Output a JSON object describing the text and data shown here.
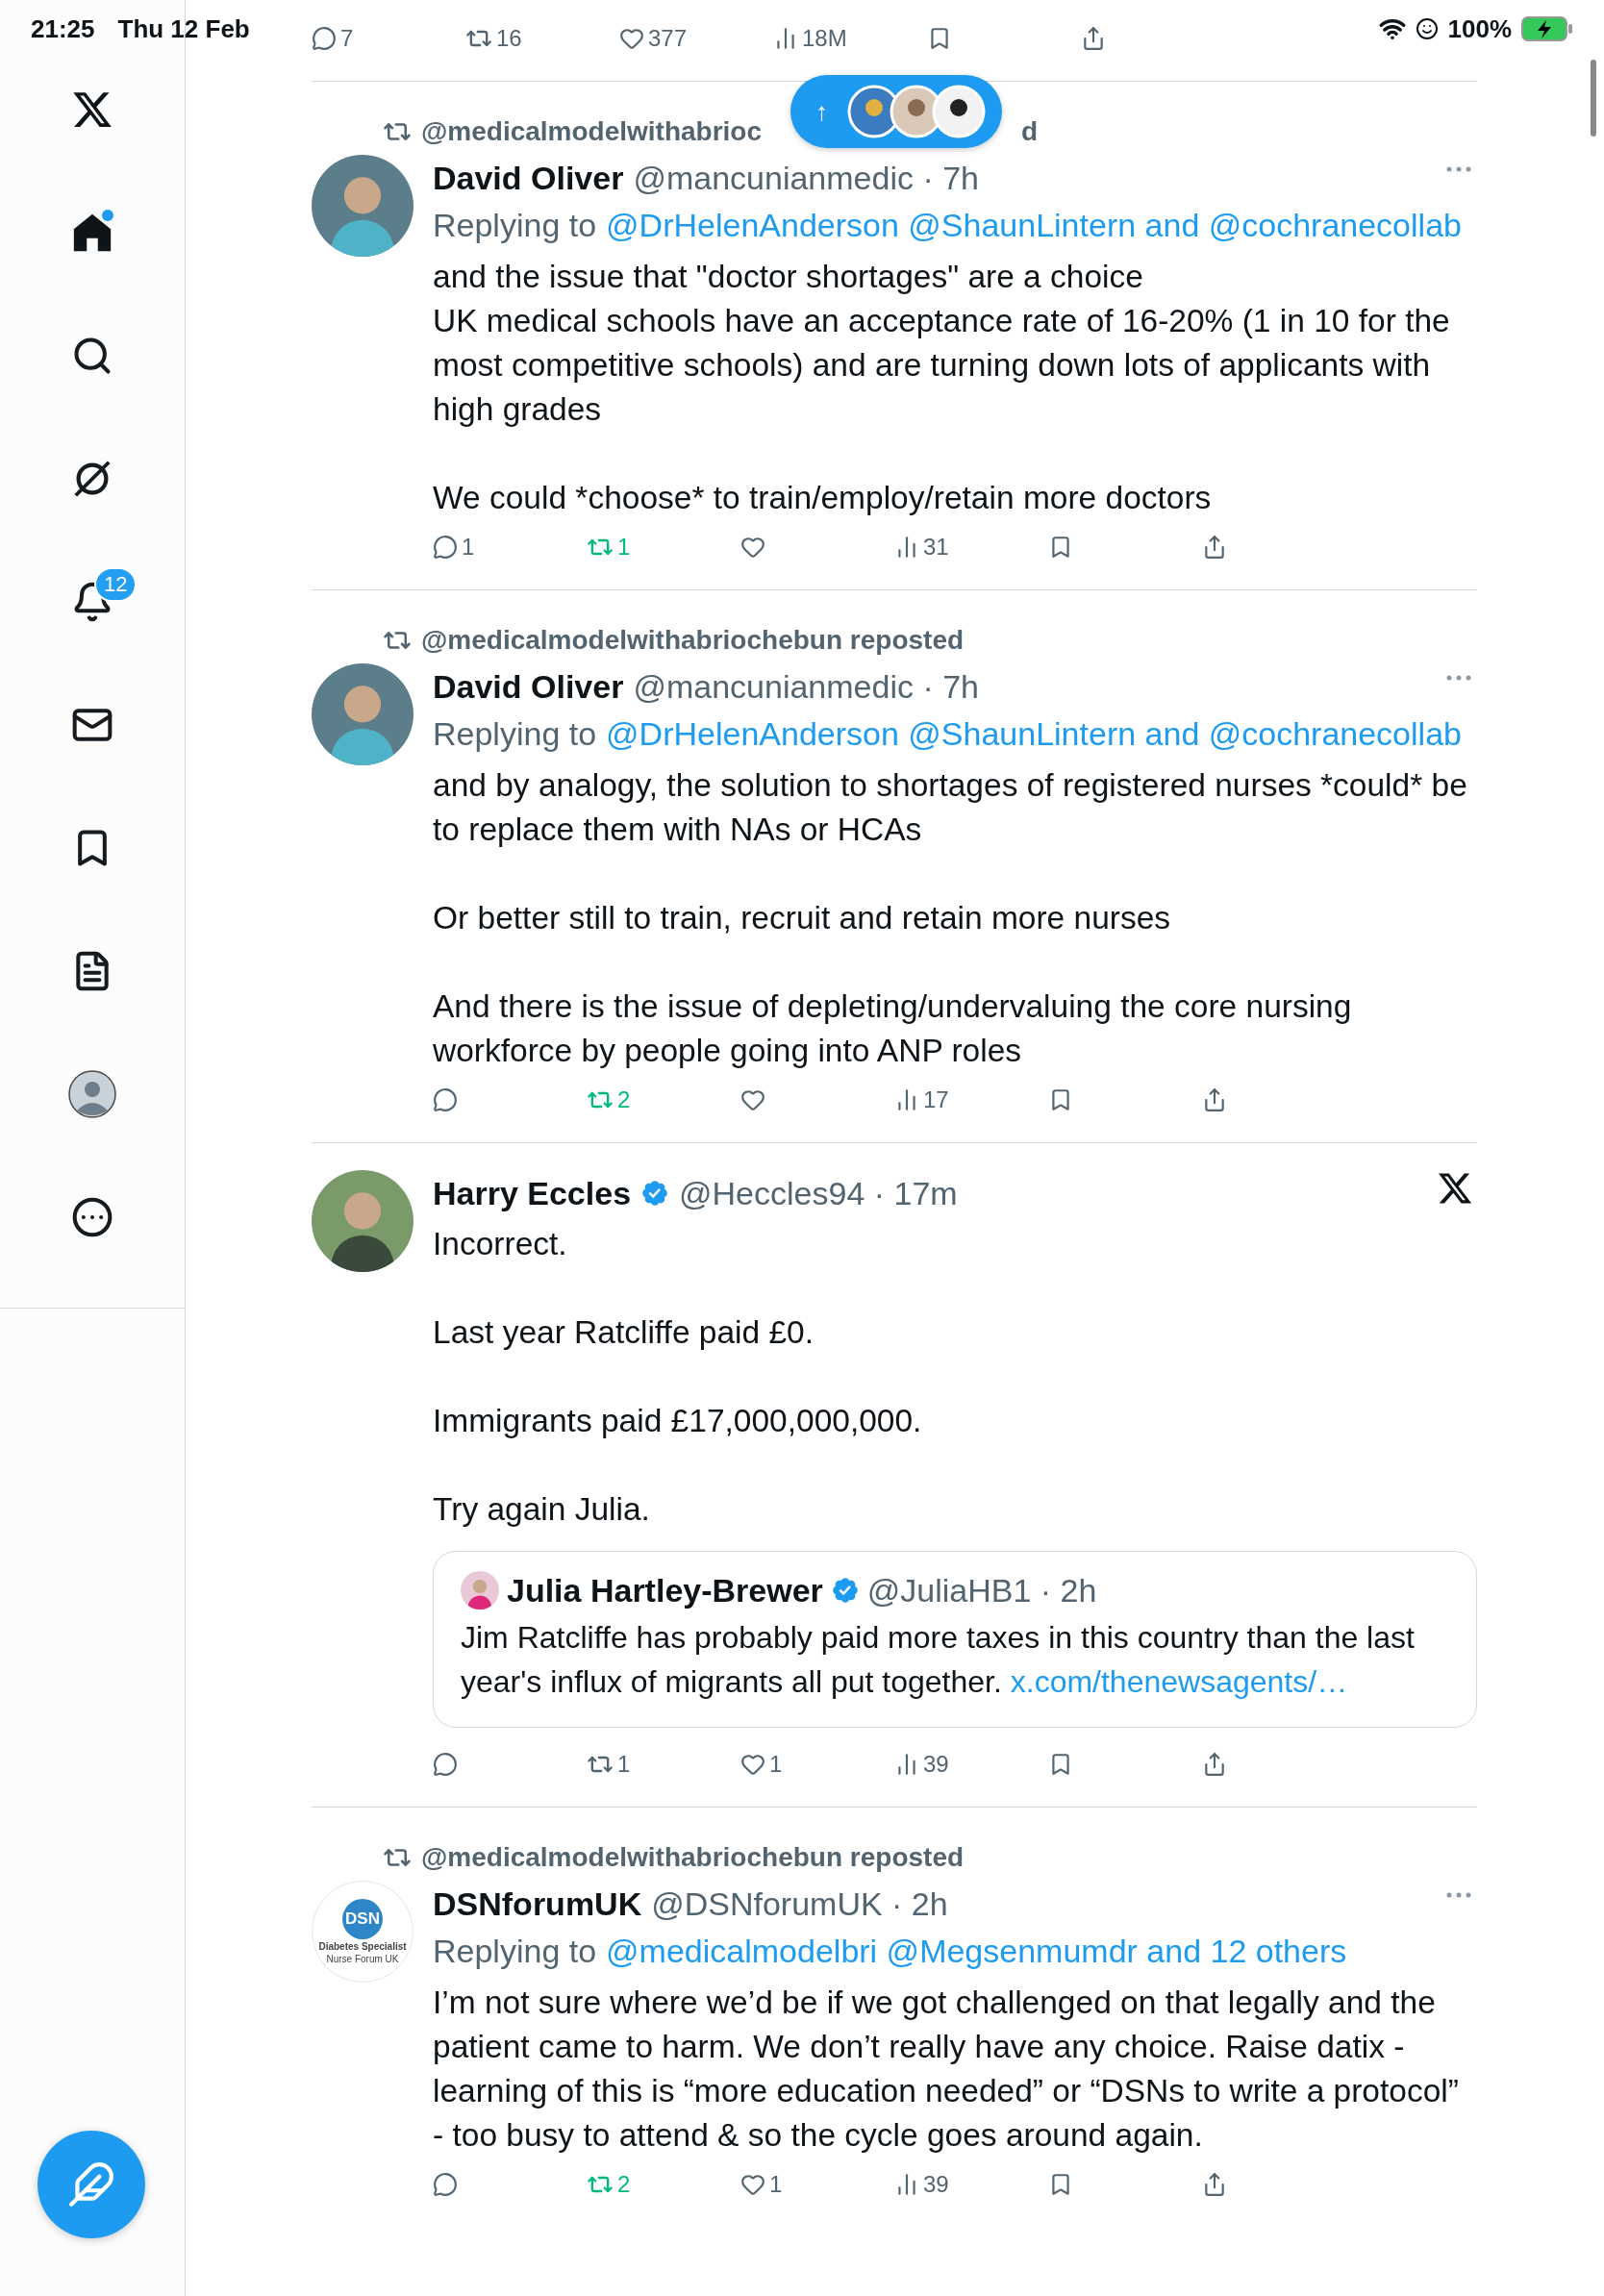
{
  "status_bar": {
    "time": "21:25",
    "date": "Thu 12 Feb",
    "battery": "100%"
  },
  "sidebar": {
    "items": [
      {
        "selected": true,
        "dot": true
      },
      {
        "selected": false
      },
      {
        "selected": false
      },
      {
        "selected": false,
        "badge": "12"
      },
      {
        "selected": false
      },
      {
        "selected": false
      },
      {
        "selected": false
      },
      {
        "selected": false
      },
      {
        "selected": false
      }
    ]
  },
  "new_posts_pill": {
    "arrow": "↑"
  },
  "partial_tweet": {
    "actions": {
      "replies": "7",
      "reposts": "16",
      "likes": "377",
      "views": "18M",
      "reposted": false
    }
  },
  "tweets": [
    {
      "repost_label_parts": [
        "@medicalmodelwithabrioc",
        "d"
      ],
      "name": "David Oliver",
      "meta": "@mancunianmedic · 7h",
      "menu": {
        "kind": "more"
      },
      "replying_label": "Replying to",
      "reply_targets": "@DrHelenAnderson @ShaunLintern and @cochranecollab",
      "text": "and the issue that \"doctor shortages\" are a choice\nUK medical schools have an acceptance rate of 16-20% (1 in 10 for the most competitive schools) and are turning down lots of applicants with high grades\n\nWe could *choose* to train/employ/retain more doctors",
      "actions": {
        "replies": "1",
        "reposts": "1",
        "views": "31",
        "reposted": true
      }
    },
    {
      "repost_label_parts": [
        "@medicalmodelwithabriochebun reposted"
      ],
      "name": "David Oliver",
      "meta": "@mancunianmedic · 7h",
      "menu": {
        "kind": "more"
      },
      "replying_label": "Replying to",
      "reply_targets": "@DrHelenAnderson @ShaunLintern and @cochranecollab",
      "text": "and by analogy, the solution to shortages of registered nurses *could* be to replace them with NAs or HCAs\n\nOr better still to train, recruit and retain more nurses\n\nAnd there is the issue of depleting/undervaluing the core nursing workforce by people going into ANP roles",
      "actions": {
        "reposts": "2",
        "views": "17",
        "reposted": true
      }
    },
    {
      "name": "Harry Eccles",
      "verified": true,
      "meta": "@Heccles94 · 17m",
      "menu": {
        "kind": "x-logo"
      },
      "text": "Incorrect.\n\nLast year Ratcliffe paid £0.\n\nImmigrants paid £17,000,000,000.\n\nTry again Julia.",
      "quote": {
        "name": "Julia Hartley-Brewer",
        "verified": true,
        "meta": "@JuliaHB1 · 2h",
        "text": "Jim Ratcliffe has probably paid more taxes in this country than the last year's influx of migrants all put together.",
        "link": "x.com/thenewsagents/…"
      },
      "actions": {
        "reposts": "1",
        "likes": "1",
        "views": "39",
        "reposted": false
      }
    },
    {
      "repost_label_parts": [
        "@medicalmodelwithabriochebun reposted"
      ],
      "name": "DSNforumUK",
      "avatar_texts": [
        "DSN",
        "Diabetes Specialist",
        "Nurse Forum UK"
      ],
      "meta": "@DSNforumUK · 2h",
      "menu": {
        "kind": "more"
      },
      "replying_label": "Replying to",
      "reply_targets": "@medicalmodelbri @Megsenmumdr and 12 others",
      "text": "I’m not sure where we’d be if we got challenged on that legally and the patient came to harm. We don’t really have any choice. Raise datix - learning of this is “more education needed” or “DSNs to write a protocol” - too busy to attend & so the cycle goes around again.",
      "actions": {
        "reposts": "2",
        "likes": "1",
        "views": "39",
        "reposted": true
      }
    }
  ]
}
